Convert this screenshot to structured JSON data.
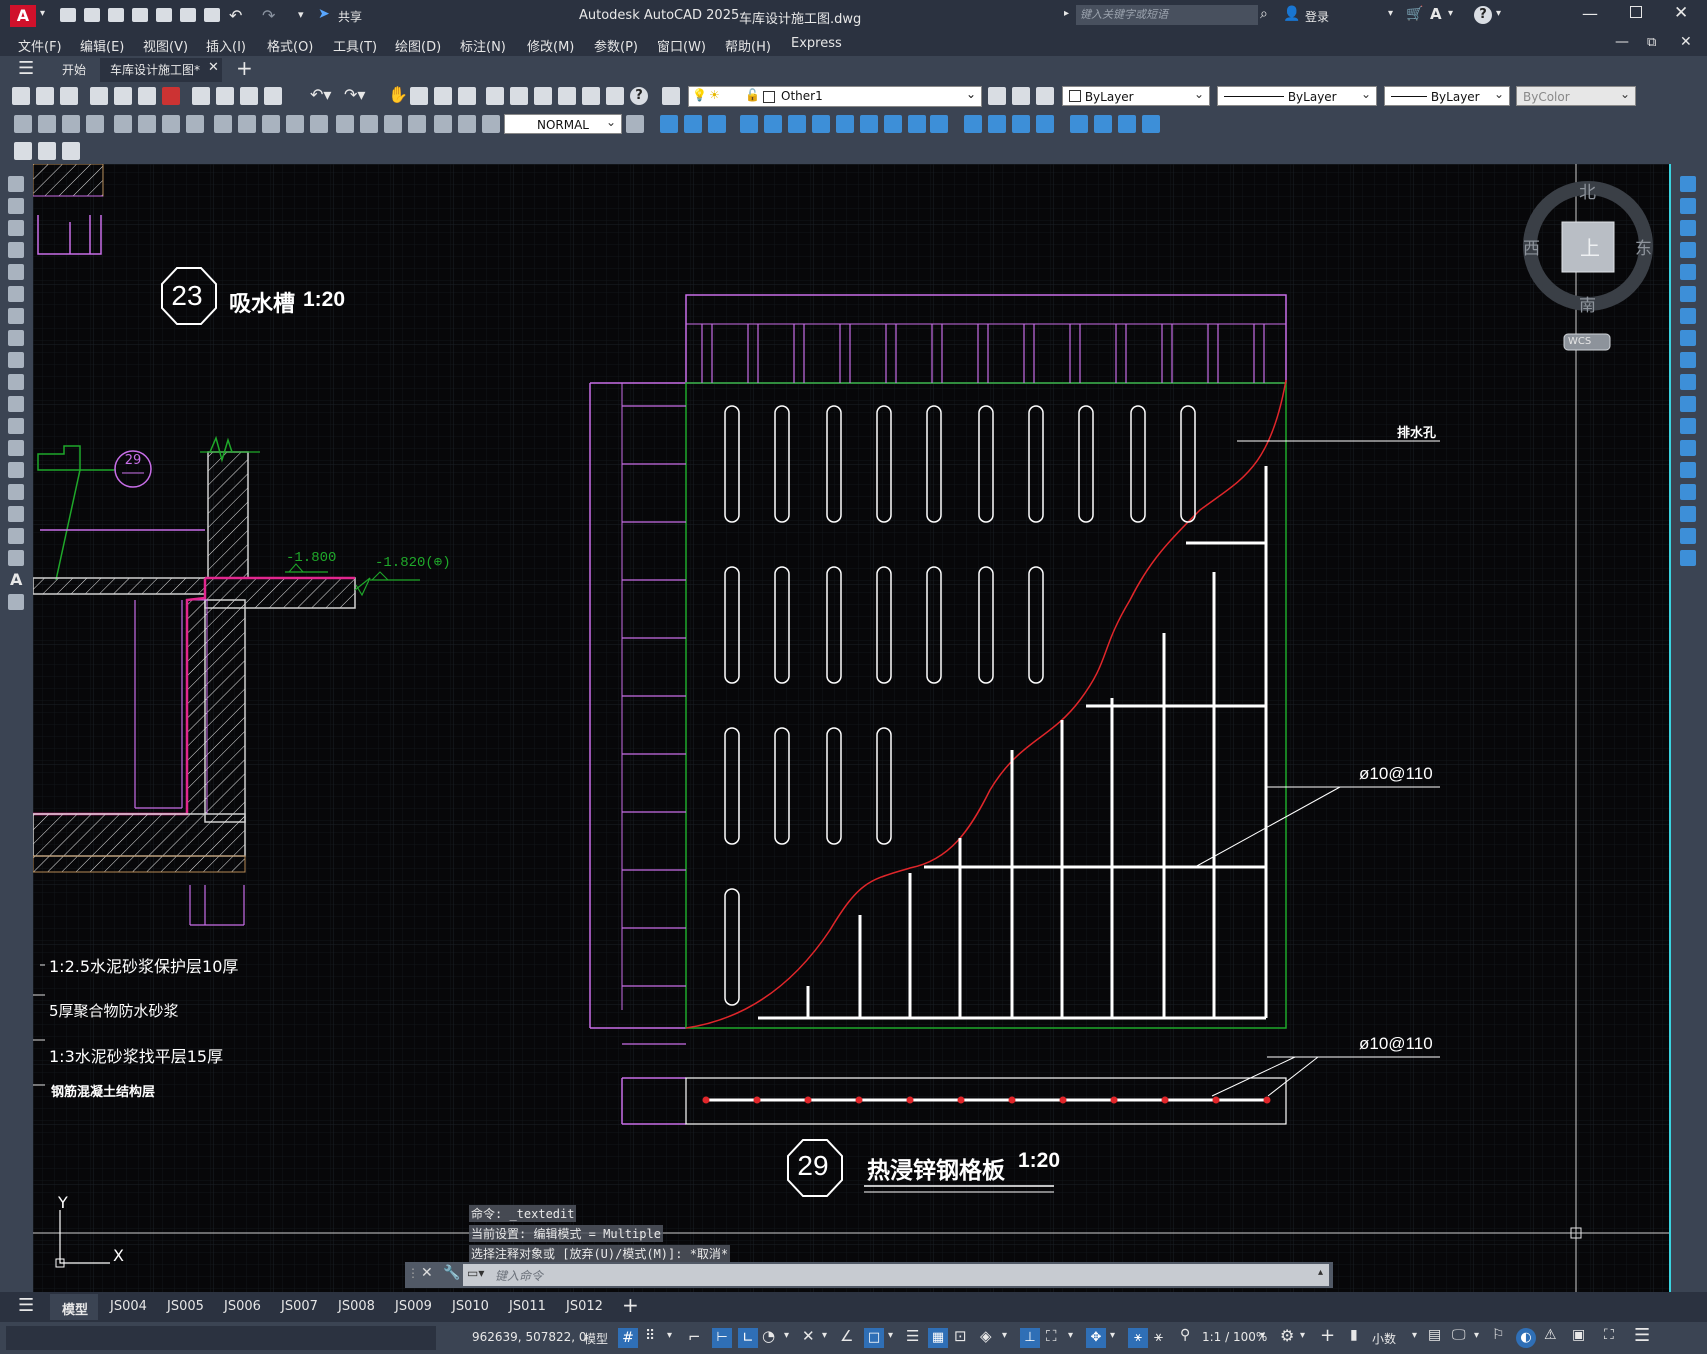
{
  "window": {
    "app_title": "Autodesk AutoCAD 2025",
    "file_title": "车库设计施工图.dwg",
    "share_label": "共享",
    "search_placeholder": "键入关键字或短语",
    "login_label": "登录"
  },
  "menu": [
    "文件(F)",
    "编辑(E)",
    "视图(V)",
    "插入(I)",
    "格式(O)",
    "工具(T)",
    "绘图(D)",
    "标注(N)",
    "修改(M)",
    "参数(P)",
    "窗口(W)",
    "帮助(H)",
    "Express"
  ],
  "doc_tabs": {
    "start": "开始",
    "active": "车库设计施工图*"
  },
  "toolbar": {
    "layer_name": "Other1",
    "color": "ByLayer",
    "linetype": "ByLayer",
    "lineweight": "ByLayer",
    "plotstyle": "ByColor",
    "dim_style": "NORMAL"
  },
  "drawing": {
    "detail23": {
      "number": "23",
      "title": "吸水槽",
      "scale": "1:20"
    },
    "detail29_ref": "29",
    "elev1": "-1.800",
    "elev2": "-1.820(⊕)",
    "notes": [
      "1:2.5水泥砂浆保护层10厚",
      "5厚聚合物防水砂浆",
      "1:3水泥砂浆找平层15厚",
      "钢筋混凝土结构层"
    ],
    "label_drain": "排水孔",
    "label_rebar1": "ø10@110",
    "label_rebar2": "ø10@110",
    "detail29": {
      "number": "29",
      "title": "热浸锌钢格板",
      "scale": "1:20"
    },
    "ucs_y": "Y",
    "ucs_x": "X"
  },
  "viewcube": {
    "north": "北",
    "south": "南",
    "east": "东",
    "west": "西",
    "top": "上",
    "wcs": "WCS"
  },
  "command": {
    "line1": "命令: _textedit",
    "line2": "当前设置: 编辑模式 = Multiple",
    "line3": "选择注释对象或 [放弃(U)/模式(M)]: *取消*",
    "placeholder": "键入命令"
  },
  "layout_tabs": [
    "模型",
    "JS004",
    "JS005",
    "JS006",
    "JS007",
    "JS008",
    "JS009",
    "JS010",
    "JS011",
    "JS012"
  ],
  "status": {
    "coords": "962639, 507822, 0",
    "model": "模型",
    "scale": "1:1 / 100%",
    "units": "小数"
  },
  "colors": {
    "canvas_bg": "#070709",
    "magenta": "#c86ee8",
    "green": "#1fa82a",
    "red": "#e0262a",
    "white": "#ffffff"
  }
}
